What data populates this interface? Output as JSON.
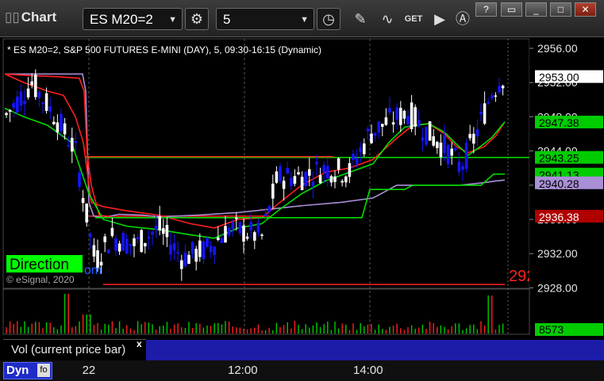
{
  "toolbar": {
    "title": "Chart",
    "symbol": "ES M20=2",
    "interval": "5"
  },
  "chart": {
    "header": "* ES M20=2, S&P 500 FUTURES E-MINI (DAY), 5, 09:30-16:15 (Dynamic)",
    "copyright": "© eSignal, 2020",
    "direction_label": "Direction",
    "direction_suffix": "om",
    "red_cut_label": "292",
    "price_scale": [
      "2956.00",
      "2952.00",
      "2948.00",
      "2944.00",
      "2940.00",
      "2936.00",
      "2932.00",
      "2928.00"
    ],
    "price_tags": [
      {
        "value": "2953.00",
        "bg": "#ffffff",
        "fg": "#000000"
      },
      {
        "value": "2947.38",
        "bg": "#00cc00",
        "fg": "#000000"
      },
      {
        "value": "2943.25",
        "bg": "#00cc00",
        "fg": "#000000"
      },
      {
        "value": "2941.13",
        "bg": "#00cc00",
        "fg": "#000000"
      },
      {
        "value": "2940.28",
        "bg": "#a98fd6",
        "fg": "#000000"
      },
      {
        "value": "2936.38",
        "bg": "#b00000",
        "fg": "#ffffff"
      }
    ],
    "time_labels": [
      "22",
      "12:00",
      "14:00"
    ],
    "colors": {
      "up": "#ffffff",
      "down": "#1515ff",
      "sma_green": "#00dd00",
      "ema_red": "#ff2020",
      "vwap_purple": "#a98fd6",
      "level_green": "#00e000",
      "level_red": "#ff2020"
    }
  },
  "volume": {
    "label": "Vol (current price bar)",
    "close_icon": "x",
    "value_tag": "8573",
    "tag_color": "#00cc00"
  },
  "footer": {
    "dyn_label": "Dyn"
  }
}
